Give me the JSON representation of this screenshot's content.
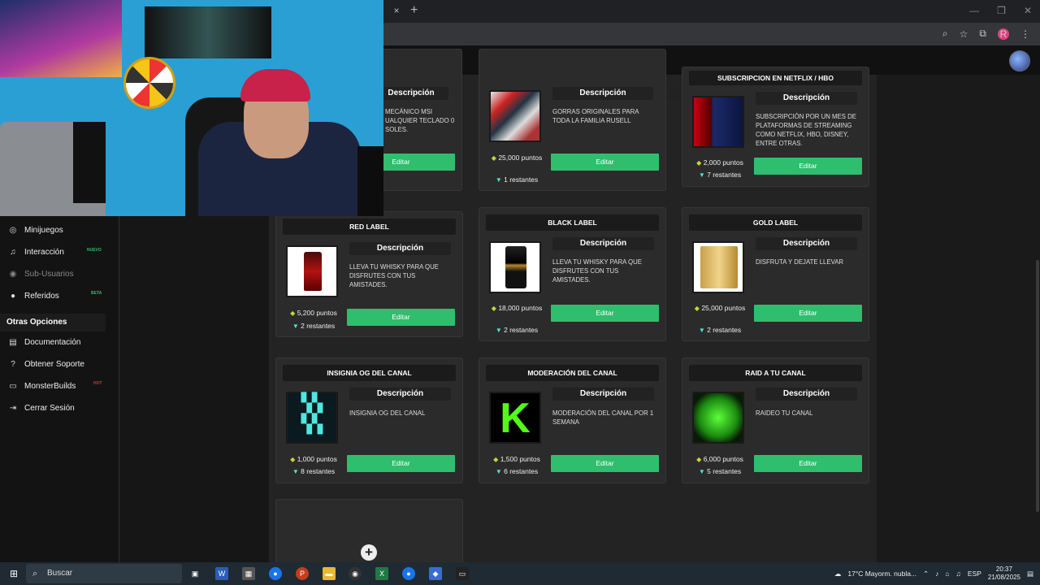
{
  "browser": {
    "close_tab": "×",
    "new_tab": "+"
  },
  "window_controls": [
    "—",
    "❐",
    "✕"
  ],
  "profile_initial": "R",
  "sidebar": {
    "items": [
      {
        "label": "Minijuegos",
        "icon": "gamepad-icon",
        "badge": ""
      },
      {
        "label": "Interacción",
        "icon": "music-icon",
        "badge": "NUEVO"
      },
      {
        "label": "Sub-Usuarios",
        "icon": "users-icon",
        "badge": ""
      },
      {
        "label": "Referidos",
        "icon": "group-icon",
        "badge": "BETA"
      }
    ],
    "section": "Otras Opciones",
    "other": [
      {
        "label": "Documentación",
        "icon": "docs-icon",
        "badge": ""
      },
      {
        "label": "Obtener Soporte",
        "icon": "help-icon",
        "badge": ""
      },
      {
        "label": "MonsterBuilds",
        "icon": "monitor-icon",
        "badge": "HOT"
      },
      {
        "label": "Cerrar Sesión",
        "icon": "logout-icon",
        "badge": ""
      }
    ]
  },
  "rewards": [
    {
      "title": "",
      "desc": "MECÁNICO MSI UALQUIER TECLADO 0 SOLES.",
      "points": "",
      "remaining": "",
      "btn": "Editar",
      "desc_head": "Descripción"
    },
    {
      "title": "",
      "desc": "GORRAS ORIGINALES PARA TODA LA FAMILIA RUSELL",
      "points": "25,000 puntos",
      "remaining": "1 restantes",
      "btn": "Editar",
      "desc_head": "Descripción"
    },
    {
      "title": "SUBSCRIPCION EN NETFLIX / HBO",
      "desc": "SUBSCRIPCIÓN POR UN MES DE PLATAFORMAS DE STREAMING COMO NETFLIX, HBO, DISNEY, ENTRE OTRAS.",
      "points": "2,000 puntos",
      "remaining": "7 restantes",
      "btn": "Editar",
      "desc_head": "Descripción"
    },
    {
      "title": "RED LABEL",
      "desc": "LLEVA TU WHISKY PARA QUE DISFRUTES CON TUS AMISTADES.",
      "points": "5,200 puntos",
      "remaining": "2 restantes",
      "btn": "Editar",
      "desc_head": "Descripción"
    },
    {
      "title": "BLACK LABEL",
      "desc": "LLEVA TU WHISKY PARA QUE DISFRUTES CON TUS AMISTADES.",
      "points": "18,000 puntos",
      "remaining": "2 restantes",
      "btn": "Editar",
      "desc_head": "Descripción"
    },
    {
      "title": "GOLD LABEL",
      "desc": "DISFRUTA Y DEJATE LLEVAR",
      "points": "25,000 puntos",
      "remaining": "2 restantes",
      "btn": "Editar",
      "desc_head": "Descripción"
    },
    {
      "title": "INSIGNIA OG DEL CANAL",
      "desc": "INSIGNIA OG DEL CANAL",
      "points": "1,000 puntos",
      "remaining": "8 restantes",
      "btn": "Editar",
      "desc_head": "Descripción"
    },
    {
      "title": "MODERACIÓN DEL CANAL",
      "desc": "MODERACIÓN DEL CANAL POR 1 SEMANA",
      "points": "1,500 puntos",
      "remaining": "6 restantes",
      "btn": "Editar",
      "desc_head": "Descripción"
    },
    {
      "title": "RAID A TU CANAL",
      "desc": "RAIDEO TU CANAL",
      "points": "6,000 puntos",
      "remaining": "5 restantes",
      "btn": "Editar",
      "desc_head": "Descripción"
    }
  ],
  "add_button": "+",
  "taskbar": {
    "search": "Buscar",
    "weather": "17°C  Mayorm. nubla...",
    "lang": "ESP",
    "time": "20:37",
    "date": "21/08/2025"
  },
  "colors": {
    "accent": "#2fbe6e",
    "bg": "#232323"
  }
}
